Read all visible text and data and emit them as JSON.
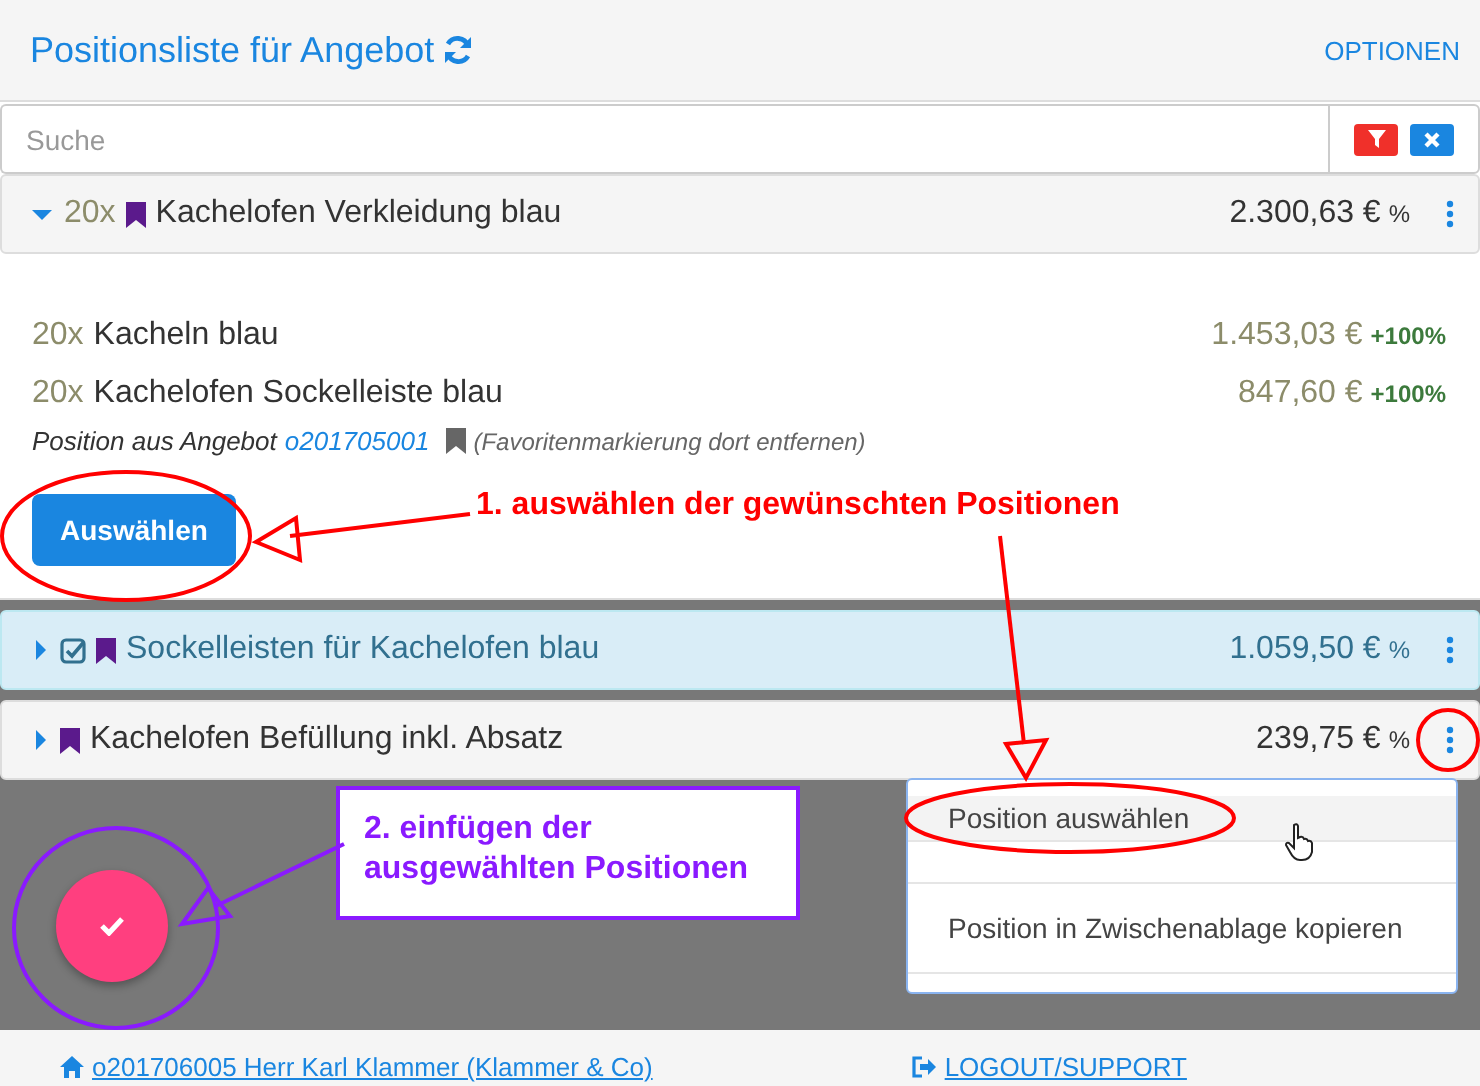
{
  "header": {
    "title": "Positionsliste für Angebot",
    "options": "OPTIONEN"
  },
  "search": {
    "placeholder": "Suche"
  },
  "positions": [
    {
      "qty": "20x",
      "name": "Kachelofen Verkleidung blau",
      "price": "2.300,63 €",
      "percent": "%",
      "expanded": true,
      "checked": false,
      "selected": false,
      "bookmarked": true,
      "children": [
        {
          "qty": "20x",
          "name": "Kacheln blau",
          "price": "1.453,03 €",
          "percent": "+100%"
        },
        {
          "qty": "20x",
          "name": "Kachelofen Sockelleiste blau",
          "price": "847,60 €",
          "percent": "+100%"
        }
      ],
      "note": {
        "text": "Position aus Angebot",
        "link": "o201705001",
        "hint": "(Favoritenmarkierung dort entfernen)"
      },
      "button": "Auswählen"
    },
    {
      "name": "Sockelleisten für Kachelofen blau",
      "price": "1.059,50 €",
      "percent": "%",
      "expanded": false,
      "checked": true,
      "selected": true,
      "bookmarked": true
    },
    {
      "name": "Kachelofen Befüllung inkl. Absatz",
      "price": "239,75 €",
      "percent": "%",
      "expanded": false,
      "checked": false,
      "selected": false,
      "bookmarked": true
    }
  ],
  "menu": [
    {
      "label": "Position auswählen",
      "selected": true
    },
    {
      "label": "Position in Zwischenablage kopieren",
      "selected": false
    }
  ],
  "annotations": [
    "1. auswählen der gewünschten Positionen",
    "2. einfügen der ausgewählten Positionen"
  ],
  "footer": {
    "customer": "o201706005 Herr Karl Klammer (Klammer & Co)",
    "logout": "LOGOUT/SUPPORT"
  }
}
